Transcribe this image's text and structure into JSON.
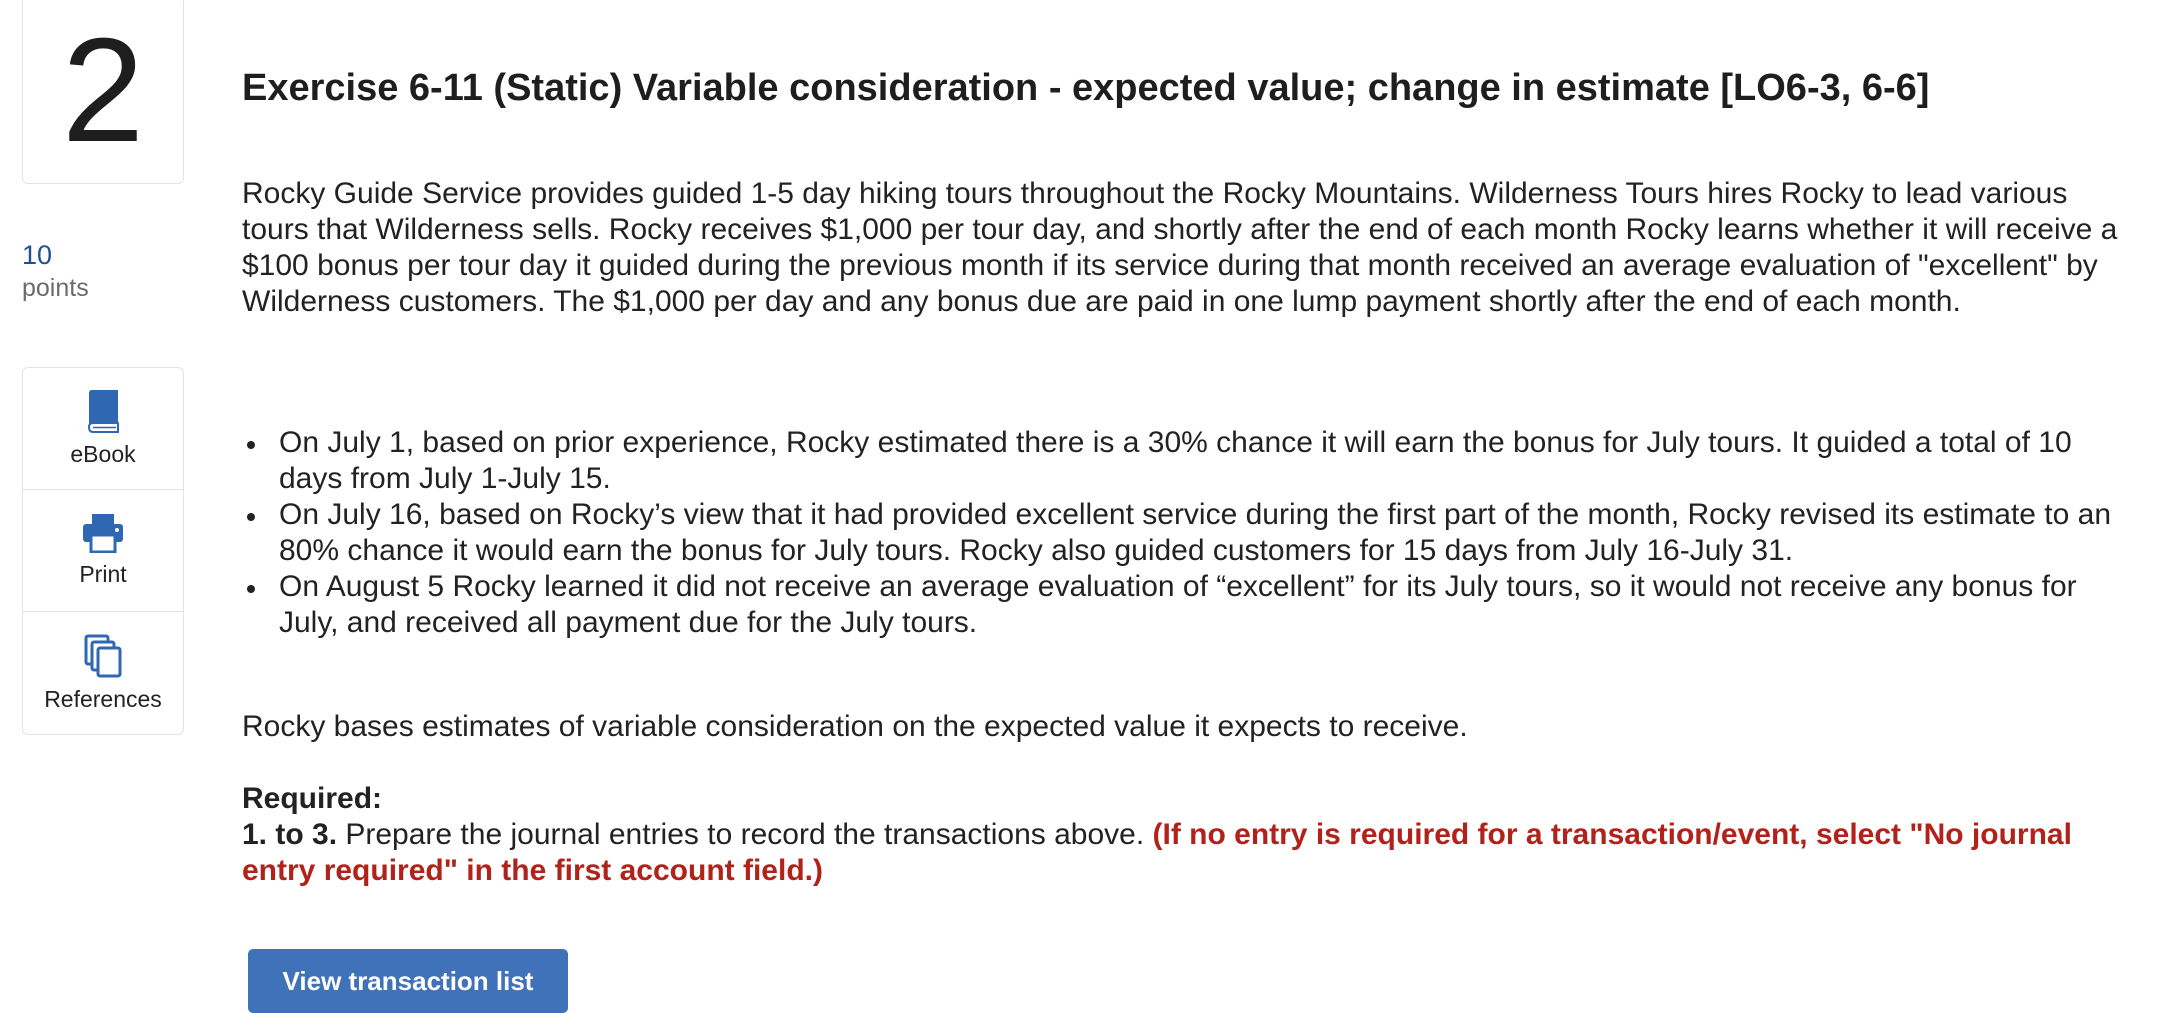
{
  "question": {
    "number": "2",
    "points_value": "10",
    "points_label": "points"
  },
  "tools": [
    {
      "label": "eBook",
      "icon": "book-icon"
    },
    {
      "label": "Print",
      "icon": "printer-icon"
    },
    {
      "label": "References",
      "icon": "references-icon"
    }
  ],
  "exercise": {
    "title": "Exercise 6-11 (Static) Variable consideration - expected value; change in estimate [LO6-3, 6-6]",
    "intro": "Rocky Guide Service provides guided 1-5 day hiking tours throughout the Rocky Mountains. Wilderness Tours hires Rocky to lead various tours that Wilderness sells. Rocky receives $1,000 per tour day, and shortly after the end of each month Rocky learns whether it will receive a $100 bonus per tour day it guided during the previous month if its service during that month received an average evaluation of \"excellent\" by Wilderness customers. The $1,000 per day and any bonus due are paid in one lump payment shortly after the end of each month.",
    "bullets": [
      "On July 1, based on prior experience, Rocky estimated there is a 30% chance it will earn the bonus for July tours. It guided a total of 10 days from July 1-July 15.",
      "On July 16, based on Rocky’s view that it had provided excellent service during the first part of the month, Rocky revised its estimate to an 80% chance it would earn the bonus for July tours. Rocky also guided customers for 15 days from July 16-July 31.",
      "On August 5 Rocky learned  it did not receive an average evaluation of “excellent” for its July tours, so it would not receive any bonus for July, and received all payment due for the July tours."
    ],
    "basis": "Rocky bases estimates of variable consideration on the expected value it expects to receive.",
    "required_heading": "Required:",
    "required_prefix": "1. to 3.",
    "required_text": " Prepare the journal entries to record the transactions above. ",
    "required_note": "(If no entry is required for a transaction/event, select \"No journal entry required\" in the first account field.)"
  },
  "buttons": {
    "view_transaction_list": "View transaction list"
  },
  "colors": {
    "accent_blue": "#3f72b8",
    "points_blue": "#1f4e93",
    "note_red": "#b0221a"
  }
}
